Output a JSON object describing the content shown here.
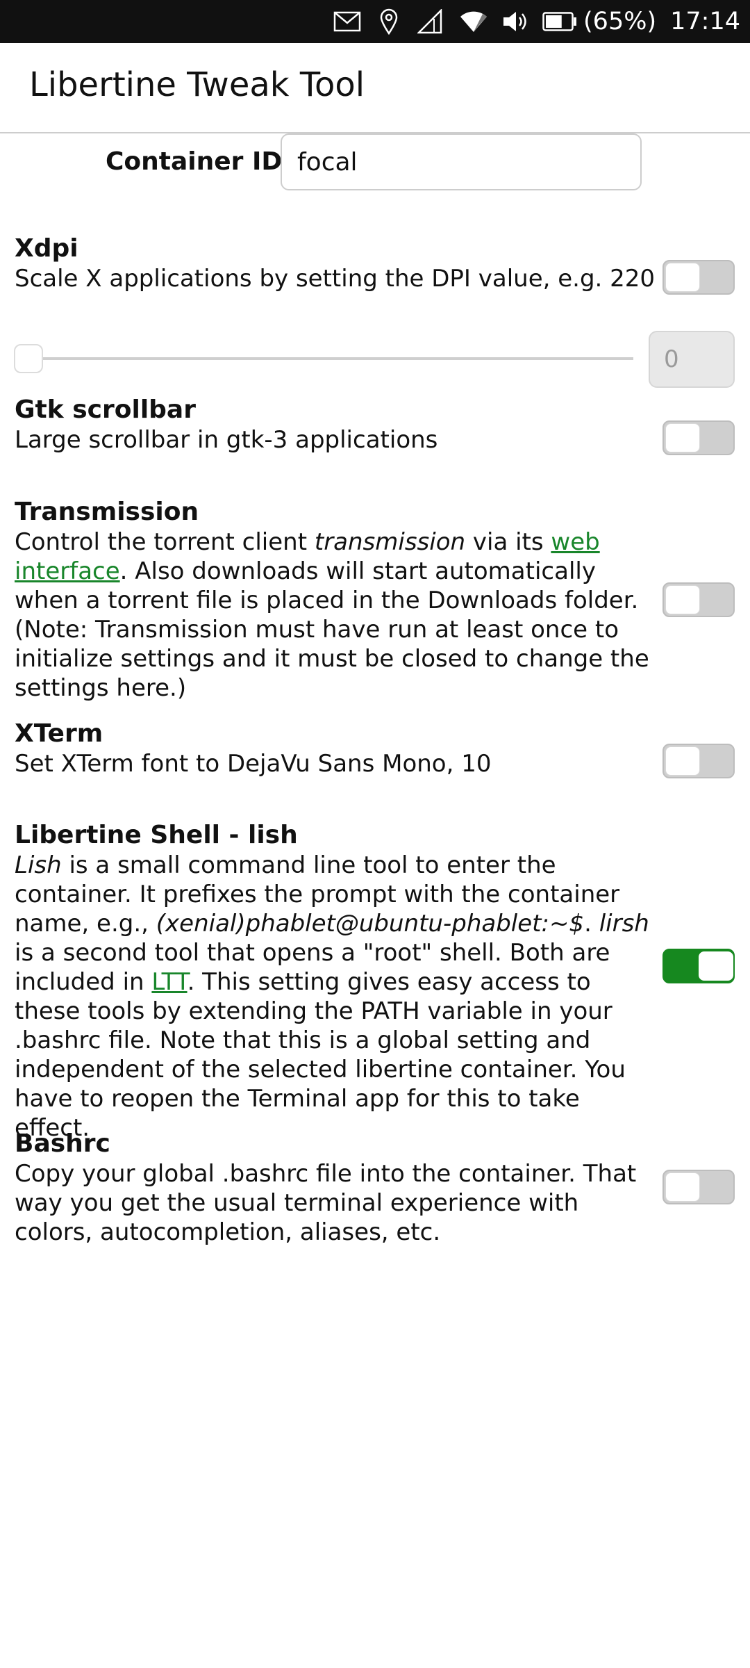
{
  "status_bar": {
    "icons": [
      "mail-icon",
      "location-icon",
      "signal-icon",
      "wifi-icon",
      "volume-icon",
      "battery-icon"
    ],
    "battery_percent": "(65%)",
    "battery_level": 0.65,
    "time": "17:14"
  },
  "header": {
    "title": "Libertine Tweak Tool"
  },
  "container": {
    "label": "Container ID:",
    "value": "focal"
  },
  "sections": [
    {
      "id": "xdpi",
      "title": "Xdpi",
      "description": "Scale X applications by setting the DPI value, e.g. 220",
      "enabled": false
    },
    {
      "id": "gtk-scrollbar",
      "title": "Gtk scrollbar",
      "description": "Large scrollbar in gtk-3 applications",
      "enabled": false
    },
    {
      "id": "transmission",
      "title": "Transmission",
      "desc_part1": "Control the torrent client ",
      "desc_italic": "transmission",
      "desc_part2": " via its ",
      "desc_link": "web interface",
      "desc_part3": ". Also downloads will start automatically when a torrent file is placed in the Downloads folder. (Note: Transmission must have run at least once to initialize settings and it must be closed to change the settings here.)",
      "enabled": false
    },
    {
      "id": "xterm",
      "title": "XTerm",
      "description": "Set XTerm font to DejaVu Sans Mono, 10",
      "enabled": false
    },
    {
      "id": "lish",
      "title": "Libertine Shell - lish",
      "desc_italic1": "Lish",
      "desc_part1": " is a small command line tool to enter the container. It prefixes the prompt with the container name, e.g., ",
      "desc_italic2": "(xenial)phablet@ubuntu-phablet:~$",
      "desc_part2": ". ",
      "desc_italic3": "lirsh",
      "desc_part3": " is a second tool that opens a \"root\" shell. Both are included in ",
      "desc_link": "LTT",
      "desc_part4": ". This setting gives easy access to these tools by extending the PATH variable in your .bashrc file. Note that this is a global setting and independent of the selected libertine container. You have to reopen the Terminal app for this to take effect.",
      "enabled": true
    },
    {
      "id": "bashrc",
      "title": "Bashrc",
      "description": "Copy your global .bashrc file into the container. That way you get the usual terminal experience with colors, autocompletion, aliases, etc.",
      "enabled": false
    }
  ],
  "xdpi_slider": {
    "value": "0",
    "level": 0
  },
  "colors": {
    "accent": "#16881f",
    "link": "#19862b",
    "status_bar": "#111111"
  }
}
